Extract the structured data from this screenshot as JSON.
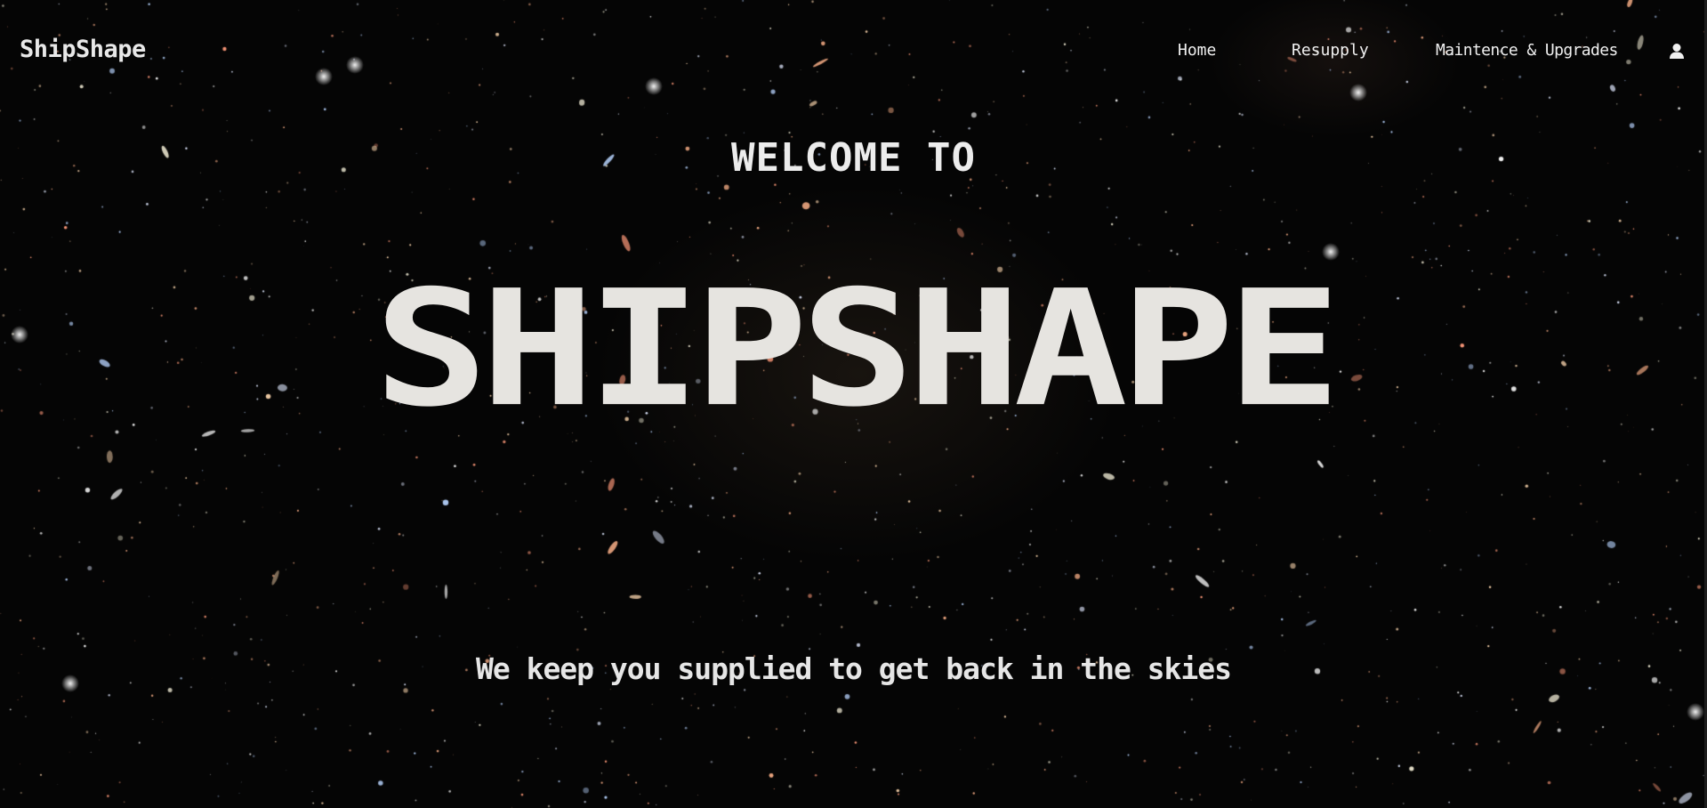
{
  "brand": {
    "name": "ShipShape"
  },
  "nav": {
    "home_label": "Home",
    "resupply_label": "Resupply",
    "maintenance_label": "Maintence & Upgrades",
    "user_icon": "user-icon"
  },
  "hero": {
    "welcome": "WELCOME TO",
    "title": "SHIPSHAPE",
    "tagline": "We keep you supplied to get back in the skies"
  },
  "theme": {
    "background": "#050505",
    "text": "#e6e4e0"
  }
}
